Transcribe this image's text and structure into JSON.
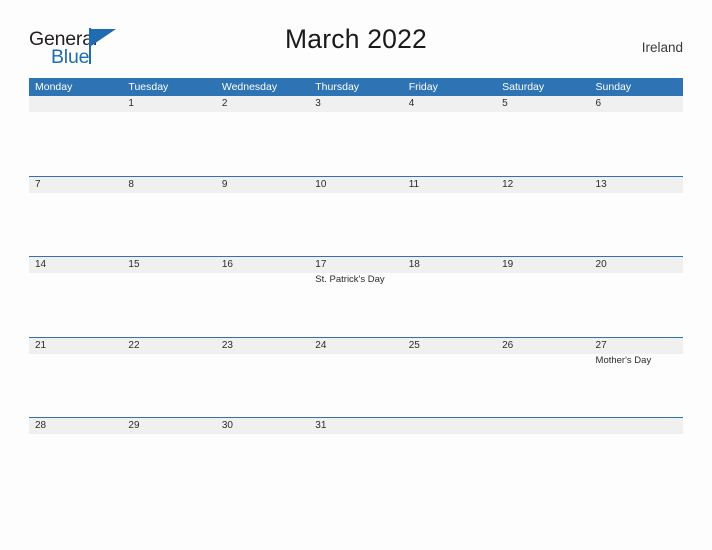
{
  "brand": {
    "name_part1": "General",
    "name_part2": "Blue",
    "color_dark": "#231f20",
    "color_blue": "#1f6cb0"
  },
  "header": {
    "title": "March 2022",
    "country": "Ireland"
  },
  "calendar": {
    "accent_color": "#2e74b5",
    "stripe_color": "#f0f0f0",
    "weekdays": [
      "Monday",
      "Tuesday",
      "Wednesday",
      "Thursday",
      "Friday",
      "Saturday",
      "Sunday"
    ],
    "weeks": [
      [
        {
          "date": "",
          "event": ""
        },
        {
          "date": "1",
          "event": ""
        },
        {
          "date": "2",
          "event": ""
        },
        {
          "date": "3",
          "event": ""
        },
        {
          "date": "4",
          "event": ""
        },
        {
          "date": "5",
          "event": ""
        },
        {
          "date": "6",
          "event": ""
        }
      ],
      [
        {
          "date": "7",
          "event": ""
        },
        {
          "date": "8",
          "event": ""
        },
        {
          "date": "9",
          "event": ""
        },
        {
          "date": "10",
          "event": ""
        },
        {
          "date": "11",
          "event": ""
        },
        {
          "date": "12",
          "event": ""
        },
        {
          "date": "13",
          "event": ""
        }
      ],
      [
        {
          "date": "14",
          "event": ""
        },
        {
          "date": "15",
          "event": ""
        },
        {
          "date": "16",
          "event": ""
        },
        {
          "date": "17",
          "event": "St. Patrick's Day"
        },
        {
          "date": "18",
          "event": ""
        },
        {
          "date": "19",
          "event": ""
        },
        {
          "date": "20",
          "event": ""
        }
      ],
      [
        {
          "date": "21",
          "event": ""
        },
        {
          "date": "22",
          "event": ""
        },
        {
          "date": "23",
          "event": ""
        },
        {
          "date": "24",
          "event": ""
        },
        {
          "date": "25",
          "event": ""
        },
        {
          "date": "26",
          "event": ""
        },
        {
          "date": "27",
          "event": "Mother's Day"
        }
      ],
      [
        {
          "date": "28",
          "event": ""
        },
        {
          "date": "29",
          "event": ""
        },
        {
          "date": "30",
          "event": ""
        },
        {
          "date": "31",
          "event": ""
        },
        {
          "date": "",
          "event": ""
        },
        {
          "date": "",
          "event": ""
        },
        {
          "date": "",
          "event": ""
        }
      ]
    ]
  }
}
